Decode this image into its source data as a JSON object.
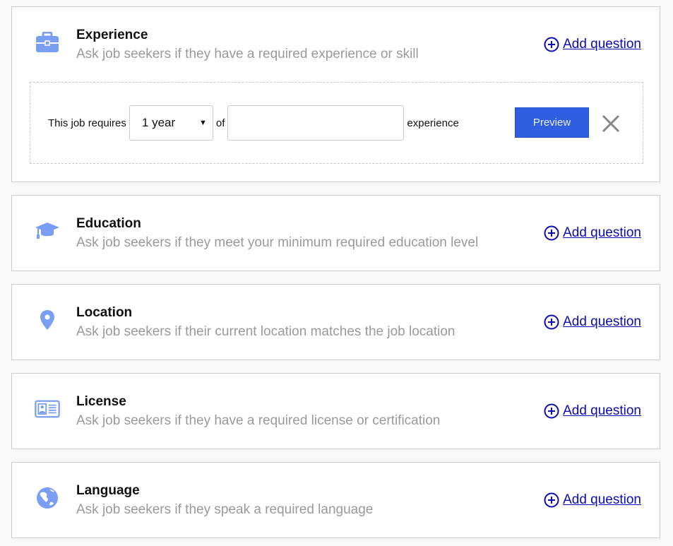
{
  "accent_color": "#7b9ef5",
  "link_color": "#0b0bb8",
  "add_label": "Add question",
  "sections": [
    {
      "title": "Experience",
      "description": "Ask job seekers if they have a required experience or skill",
      "icon": "briefcase-icon"
    },
    {
      "title": "Education",
      "description": "Ask job seekers if they meet your minimum required education level",
      "icon": "graduation-cap-icon"
    },
    {
      "title": "Location",
      "description": "Ask job seekers if their current location matches the job location",
      "icon": "map-pin-icon"
    },
    {
      "title": "License",
      "description": "Ask job seekers if they have a required license or certification",
      "icon": "id-card-icon"
    },
    {
      "title": "Language",
      "description": "Ask job seekers if they speak a required language",
      "icon": "globe-icon"
    }
  ],
  "experience_editor": {
    "prefix": "This job requires",
    "duration_value": "1 year",
    "of_label": "of",
    "skill_value": "",
    "suffix": "experience",
    "preview_label": "Preview"
  }
}
